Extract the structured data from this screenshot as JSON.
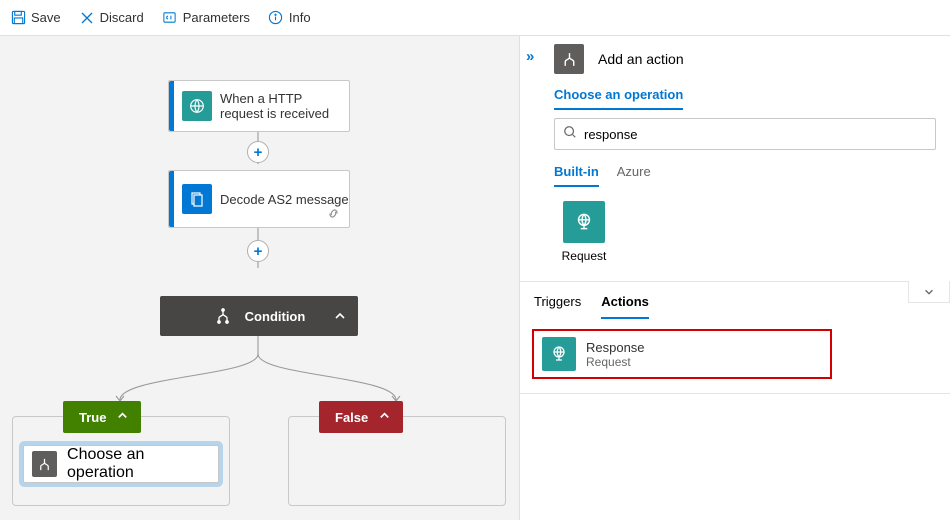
{
  "toolbar": {
    "save": "Save",
    "discard": "Discard",
    "parameters": "Parameters",
    "info": "Info"
  },
  "canvas": {
    "trigger": {
      "title": "When a HTTP request is received"
    },
    "action1": {
      "title": "Decode AS2 message"
    },
    "condition": {
      "title": "Condition"
    },
    "true_label": "True",
    "false_label": "False",
    "choose_op": "Choose an operation"
  },
  "panel": {
    "title": "Add an action",
    "choose_tab": "Choose an operation",
    "search_value": "response",
    "src_tabs": {
      "builtin": "Built-in",
      "azure": "Azure"
    },
    "connector": {
      "name": "Request"
    },
    "op_tabs": {
      "triggers": "Triggers",
      "actions": "Actions"
    },
    "op": {
      "title": "Response",
      "sub": "Request"
    }
  }
}
